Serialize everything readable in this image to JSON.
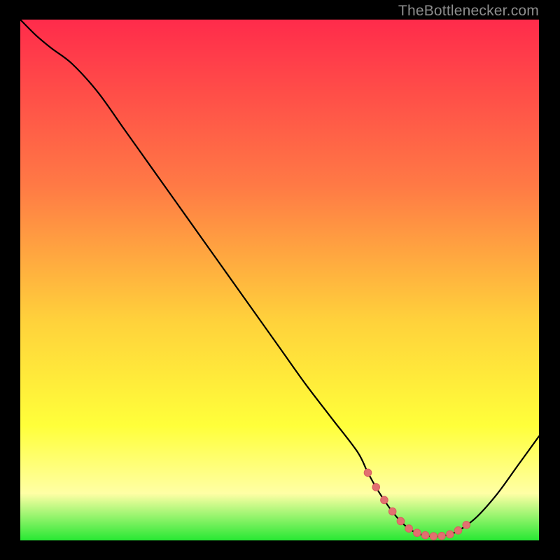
{
  "watermark": "TheBottlenecker.com",
  "colors": {
    "grad_top": "#ff2b4b",
    "grad_mid1": "#ff7a45",
    "grad_mid2": "#ffd23b",
    "grad_yellow": "#ffff3a",
    "grad_lightyellow": "#ffffa5",
    "grad_green": "#27e833",
    "curve": "#000000",
    "marker_fill": "#e27070",
    "marker_stroke": "#d85f5f",
    "frame": "#000000"
  },
  "chart_data": {
    "type": "line",
    "title": "",
    "xlabel": "",
    "ylabel": "",
    "xlim": [
      0,
      100
    ],
    "ylim": [
      0,
      100
    ],
    "grid": false,
    "legend": false,
    "series": [
      {
        "name": "bottleneck-curve",
        "x": [
          0,
          3,
          6,
          10,
          15,
          20,
          25,
          30,
          35,
          40,
          45,
          50,
          55,
          60,
          65,
          67,
          69,
          71,
          73,
          75,
          77,
          79,
          81,
          83,
          85,
          88,
          92,
          96,
          100
        ],
        "y": [
          100,
          97,
          94.5,
          91.5,
          86,
          79,
          72,
          65,
          58,
          51,
          44,
          37,
          30,
          23.5,
          17,
          13,
          9.5,
          6.5,
          4,
          2.2,
          1.2,
          0.8,
          0.8,
          1.2,
          2.2,
          4.5,
          9,
          14.5,
          20
        ]
      }
    ],
    "markers": {
      "name": "optimal-zone",
      "x_range": [
        67,
        86
      ],
      "count": 13
    }
  }
}
